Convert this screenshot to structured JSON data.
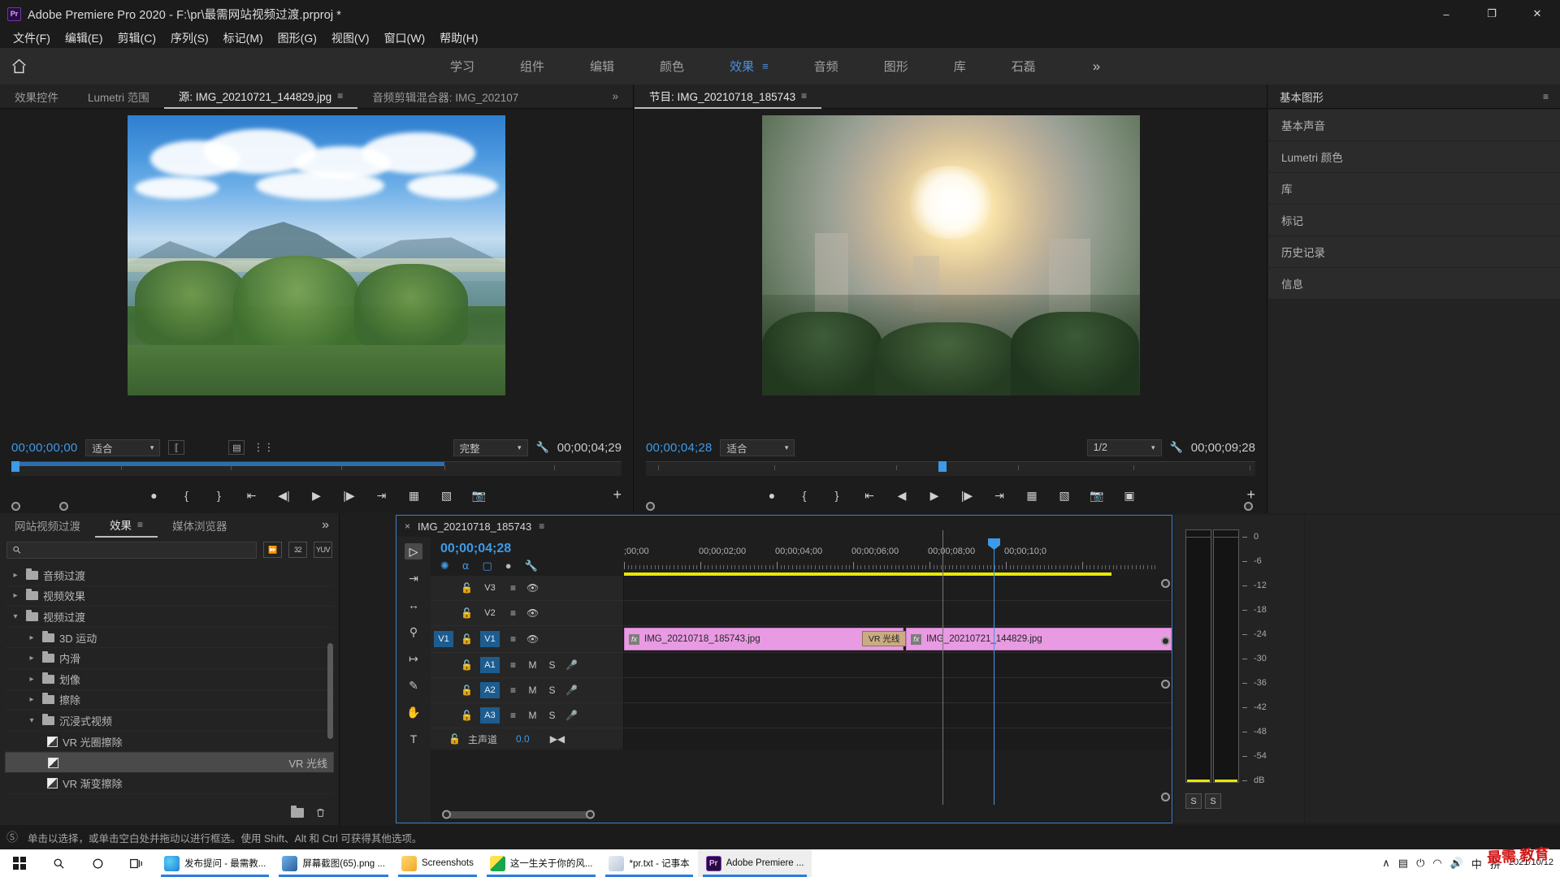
{
  "titlebar": {
    "app_badge": "Pr",
    "title": "Adobe Premiere Pro 2020 - F:\\pr\\最需网站视频过渡.prproj *",
    "minimize": "–",
    "maximize": "❐",
    "close": "✕"
  },
  "menubar": {
    "items": [
      "文件(F)",
      "编辑(E)",
      "剪辑(C)",
      "序列(S)",
      "标记(M)",
      "图形(G)",
      "视图(V)",
      "窗口(W)",
      "帮助(H)"
    ]
  },
  "workspace": {
    "home_icon": "home-icon",
    "tabs": [
      {
        "label": "学习",
        "active": false
      },
      {
        "label": "组件",
        "active": false
      },
      {
        "label": "编辑",
        "active": false
      },
      {
        "label": "颜色",
        "active": false
      },
      {
        "label": "效果",
        "active": true
      },
      {
        "label": "音频",
        "active": false
      },
      {
        "label": "图形",
        "active": false
      },
      {
        "label": "库",
        "active": false
      },
      {
        "label": "石磊",
        "active": false
      }
    ],
    "overflow": "»",
    "accent_color": "#4a90e2"
  },
  "source_panel": {
    "tabs": [
      {
        "label": "效果控件",
        "active": false
      },
      {
        "label": "Lumetri 范围",
        "active": false
      },
      {
        "label": "源: IMG_20210721_144829.jpg",
        "active": true,
        "menu": "≡"
      },
      {
        "label": "音频剪辑混合器: IMG_202107",
        "active": false
      }
    ],
    "overflow": "»",
    "current_time": "00;00;00;00",
    "fit_select": "适合",
    "quality_select": "完整",
    "duration": "00;00;04;29",
    "buttons": [
      "marker-button",
      "mark-in-button",
      "mark-out-button",
      "go-to-in-button",
      "step-back-button",
      "play-button",
      "step-forward-button",
      "go-to-out-button",
      "insert-button",
      "overwrite-button",
      "export-frame-button"
    ],
    "add-button": "+"
  },
  "program_panel": {
    "tab_label": "节目: IMG_20210718_185743",
    "tab_menu": "≡",
    "current_time": "00;00;04;28",
    "fit_select": "适合",
    "resolution_select": "1/2",
    "duration": "00;00;09;28",
    "add-button": "+"
  },
  "right_panel": {
    "header": "基本图形",
    "header_menu": "≡",
    "items": [
      "基本声音",
      "Lumetri 颜色",
      "库",
      "标记",
      "历史记录",
      "信息"
    ]
  },
  "effects_panel": {
    "tabs": [
      {
        "label": "网站视频过渡",
        "active": false
      },
      {
        "label": "效果",
        "active": true,
        "menu": "≡"
      },
      {
        "label": "媒体浏览器",
        "active": false
      }
    ],
    "overflow": "»",
    "search_placeholder": "",
    "search_value": "",
    "filter_buttons": [
      "accelerated-effects-icon",
      "32-bit-color-icon",
      "yuv-color-icon"
    ],
    "tree": [
      {
        "label": "音频过渡",
        "type": "folder",
        "depth": 0,
        "expanded": false,
        "selected": false
      },
      {
        "label": "视频效果",
        "type": "folder",
        "depth": 0,
        "expanded": false,
        "selected": false
      },
      {
        "label": "视频过渡",
        "type": "folder",
        "depth": 0,
        "expanded": true,
        "selected": false
      },
      {
        "label": "3D 运动",
        "type": "folder",
        "depth": 1,
        "expanded": false,
        "selected": false
      },
      {
        "label": "内滑",
        "type": "folder",
        "depth": 1,
        "expanded": false,
        "selected": false
      },
      {
        "label": "划像",
        "type": "folder",
        "depth": 1,
        "expanded": false,
        "selected": false
      },
      {
        "label": "擦除",
        "type": "folder",
        "depth": 1,
        "expanded": false,
        "selected": false
      },
      {
        "label": "沉浸式视频",
        "type": "folder",
        "depth": 1,
        "expanded": true,
        "selected": false
      },
      {
        "label": "VR 光圈擦除",
        "type": "effect",
        "depth": 2,
        "selected": false
      },
      {
        "label": "VR 光线",
        "type": "effect",
        "depth": 2,
        "selected": true
      },
      {
        "label": "VR 渐变擦除",
        "type": "effect",
        "depth": 2,
        "selected": false
      }
    ],
    "footer_buttons": [
      "new-bin-icon",
      "delete-icon"
    ]
  },
  "timeline": {
    "close": "×",
    "sequence_name": "IMG_20210718_185743",
    "menu": "≡",
    "current_time": "00;00;04;28",
    "tools": [
      "selection-tool",
      "track-select-forward-tool",
      "ripple-edit-tool",
      "razor-tool",
      "slip-tool",
      "pen-tool",
      "hand-tool",
      "type-tool"
    ],
    "header_toggles": [
      "nest-toggle-icon",
      "snap-magnet-icon",
      "linked-selection-icon",
      "add-marker-icon",
      "timeline-settings-icon"
    ],
    "ruler_labels": [
      ";00;00",
      "00;00;02;00",
      "00;00;04;00",
      "00;00;06;00",
      "00;00;08;00",
      "00;00;10;0"
    ],
    "tracks": [
      {
        "name": "V3",
        "type": "video",
        "source_target": "",
        "target_on": false,
        "lock": "lock-icon"
      },
      {
        "name": "V2",
        "type": "video",
        "source_target": "",
        "target_on": false,
        "lock": "lock-icon"
      },
      {
        "name": "V1",
        "type": "video",
        "source_target": "V1",
        "target_on": true,
        "lock": "lock-icon"
      },
      {
        "name": "A1",
        "type": "audio",
        "source_target": "",
        "target_on": true,
        "lock": "lock-icon",
        "mute": "M",
        "solo": "S"
      },
      {
        "name": "A2",
        "type": "audio",
        "source_target": "",
        "target_on": true,
        "lock": "lock-icon",
        "mute": "M",
        "solo": "S"
      },
      {
        "name": "A3",
        "type": "audio",
        "source_target": "",
        "target_on": true,
        "lock": "lock-icon",
        "mute": "M",
        "solo": "S"
      }
    ],
    "clips": [
      {
        "label": "IMG_20210718_185743.jpg",
        "track": "V1",
        "fx": "fx",
        "left_pct": 0.0,
        "width_pct": 54.5,
        "color": "#e89ae2"
      },
      {
        "label": "IMG_20210721_144829.jpg",
        "track": "V1",
        "fx": "fx",
        "left_pct": 55.2,
        "width_pct": 44.8,
        "color": "#e89ae2"
      }
    ],
    "transition": {
      "label": "VR 光线",
      "left_pct": 45.0,
      "width_pct": 9.5,
      "color": "#c9ac83"
    },
    "master_track": {
      "label": "主声道",
      "value": "0.0",
      "lock": "lock-icon"
    }
  },
  "audio_meters": {
    "scale": [
      "0",
      "-6",
      "-12",
      "-18",
      "-24",
      "-30",
      "-36",
      "-42",
      "-48",
      "-54",
      "dB"
    ],
    "solo_buttons": [
      "S",
      "S"
    ],
    "level_color": "#e8e800"
  },
  "statusbar": {
    "icon": "no-drop-icon",
    "message": "单击以选择，或单击空白处并拖动以进行框选。使用 Shift、Alt 和 Ctrl 可获得其他选项。"
  },
  "taskbar": {
    "system_buttons": [
      "start-icon",
      "search-icon",
      "cortana-icon",
      "task-view-icon"
    ],
    "apps": [
      {
        "label": "发布提问 - 最需教...",
        "color": "#1e9bd7",
        "active": false
      },
      {
        "label": "屏幕截图(65).png ...",
        "color": "#3a6ea5",
        "active": false
      },
      {
        "label": "Screenshots",
        "color": "#f5c253",
        "active": false
      },
      {
        "label": "这一生关于你的风...",
        "color": "#1aa34a",
        "active": false
      },
      {
        "label": "*pr.txt - 记事本",
        "color": "#cfd8e3",
        "active": false
      },
      {
        "label": "Adobe Premiere ...",
        "color": "#9b4dca",
        "active": true
      }
    ],
    "tray": [
      "∧",
      "tray-network-icon",
      "tray-battery-icon",
      "tray-wifi-icon",
      "tray-volume-icon",
      "中",
      "拼"
    ],
    "clock_date": "2021/10/12",
    "watermark": "最需 教育"
  }
}
